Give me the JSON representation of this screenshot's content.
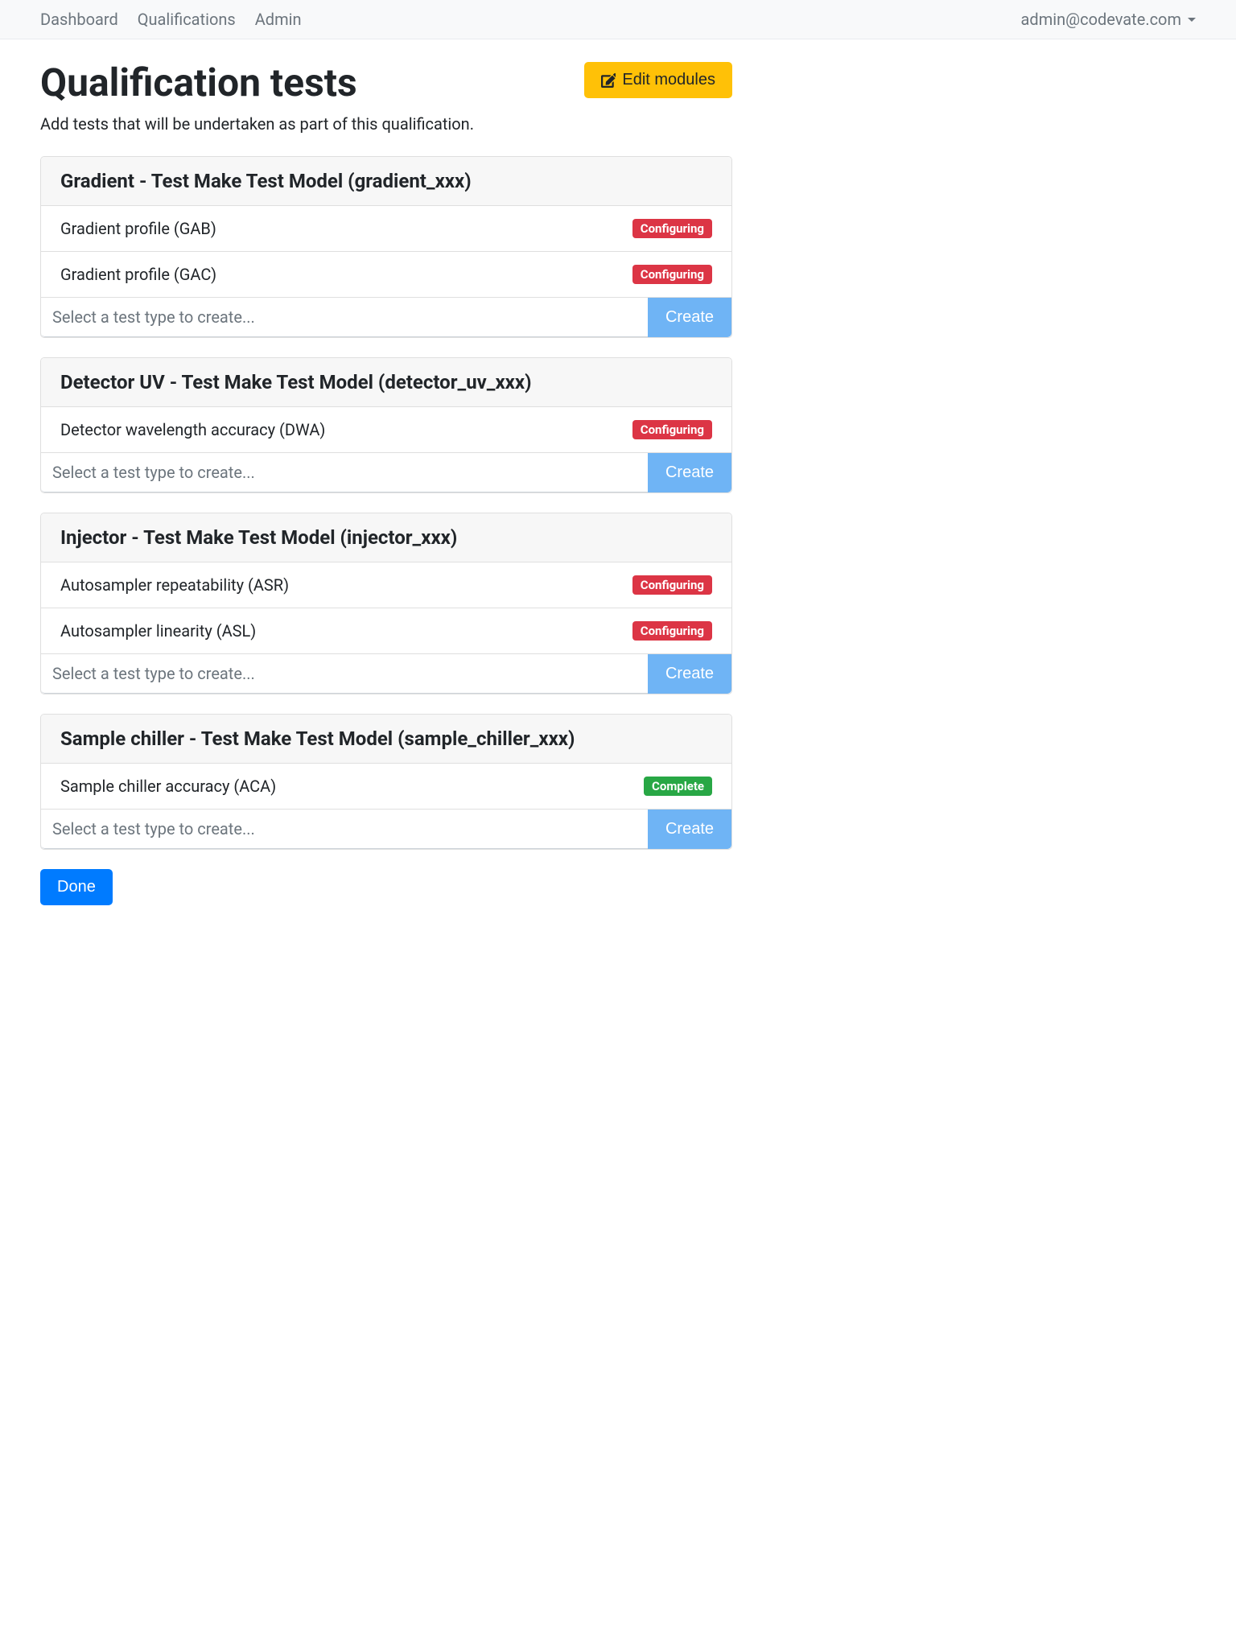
{
  "nav": {
    "links": [
      "Dashboard",
      "Qualifications",
      "Admin"
    ],
    "user": "admin@codevate.com"
  },
  "page": {
    "title": "Qualification tests",
    "subtitle": "Add tests that will be undertaken as part of this qualification.",
    "edit_modules_label": "Edit modules",
    "done_label": "Done"
  },
  "select_placeholder": "Select a test type to create...",
  "create_label": "Create",
  "status_labels": {
    "configuring": "Configuring",
    "complete": "Complete"
  },
  "modules": [
    {
      "title": "Gradient - Test Make Test Model (gradient_xxx)",
      "tests": [
        {
          "name": "Gradient profile (GAB)",
          "status": "configuring"
        },
        {
          "name": "Gradient profile (GAC)",
          "status": "configuring"
        }
      ]
    },
    {
      "title": "Detector UV - Test Make Test Model (detector_uv_xxx)",
      "tests": [
        {
          "name": "Detector wavelength accuracy (DWA)",
          "status": "configuring"
        }
      ]
    },
    {
      "title": "Injector - Test Make Test Model (injector_xxx)",
      "tests": [
        {
          "name": "Autosampler repeatability (ASR)",
          "status": "configuring"
        },
        {
          "name": "Autosampler linearity (ASL)",
          "status": "configuring"
        }
      ]
    },
    {
      "title": "Sample chiller - Test Make Test Model (sample_chiller_xxx)",
      "tests": [
        {
          "name": "Sample chiller accuracy (ACA)",
          "status": "complete"
        }
      ]
    }
  ]
}
